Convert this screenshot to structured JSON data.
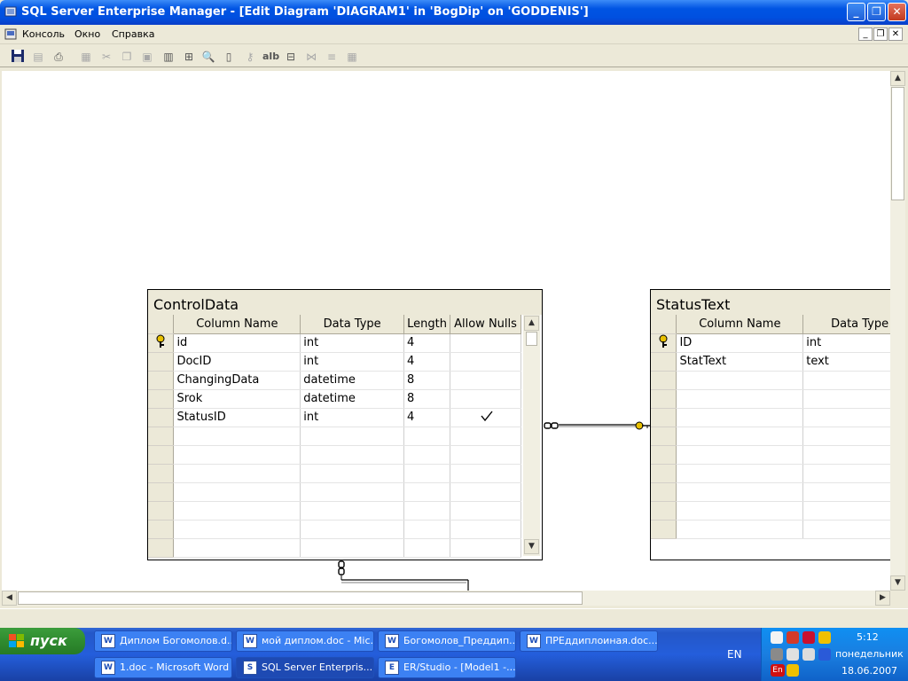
{
  "window": {
    "title": "SQL Server Enterprise Manager - [Edit Diagram 'DIAGRAM1' in 'BogDip' on 'GODDENIS']"
  },
  "menu": {
    "items": [
      "Консоль",
      "Окно",
      "Справка"
    ]
  },
  "tables": [
    {
      "name": "ControlData",
      "columns": [
        "Column Name",
        "Data Type",
        "Length",
        "Allow Nulls"
      ],
      "rows": [
        {
          "name": "id",
          "type": "int",
          "length": "4",
          "allow_nulls": false,
          "key": true
        },
        {
          "name": "DocID",
          "type": "int",
          "length": "4",
          "allow_nulls": false,
          "key": false
        },
        {
          "name": "ChangingData",
          "type": "datetime",
          "length": "8",
          "allow_nulls": false,
          "key": false
        },
        {
          "name": "Srok",
          "type": "datetime",
          "length": "8",
          "allow_nulls": false,
          "key": false
        },
        {
          "name": "StatusID",
          "type": "int",
          "length": "4",
          "allow_nulls": true,
          "key": false
        }
      ]
    },
    {
      "name": "StatusText",
      "columns": [
        "Column Name",
        "Data Type"
      ],
      "rows": [
        {
          "name": "ID",
          "type": "int",
          "key": true
        },
        {
          "name": "StatText",
          "type": "text",
          "key": false
        }
      ]
    }
  ],
  "taskbar": {
    "start_label": "пуск",
    "buttons": [
      "Диплом Богомолов.d...",
      "мой диплом.doc - Mic...",
      "Богомолов_Преддип...",
      "ПРЕддиплоиная.doc...",
      "1.doc - Microsoft Word",
      "SQL Server Enterpris...",
      "ER/Studio - [Model1 -..."
    ],
    "active_index": 5,
    "lang": "EN",
    "time": "5:12",
    "day": "понедельник",
    "date": "18.06.2007"
  },
  "colors": {
    "titlebar": "#0054e3",
    "taskbar": "#245edb",
    "start": "#2f8b2f",
    "key_icon": "#e8c000"
  }
}
